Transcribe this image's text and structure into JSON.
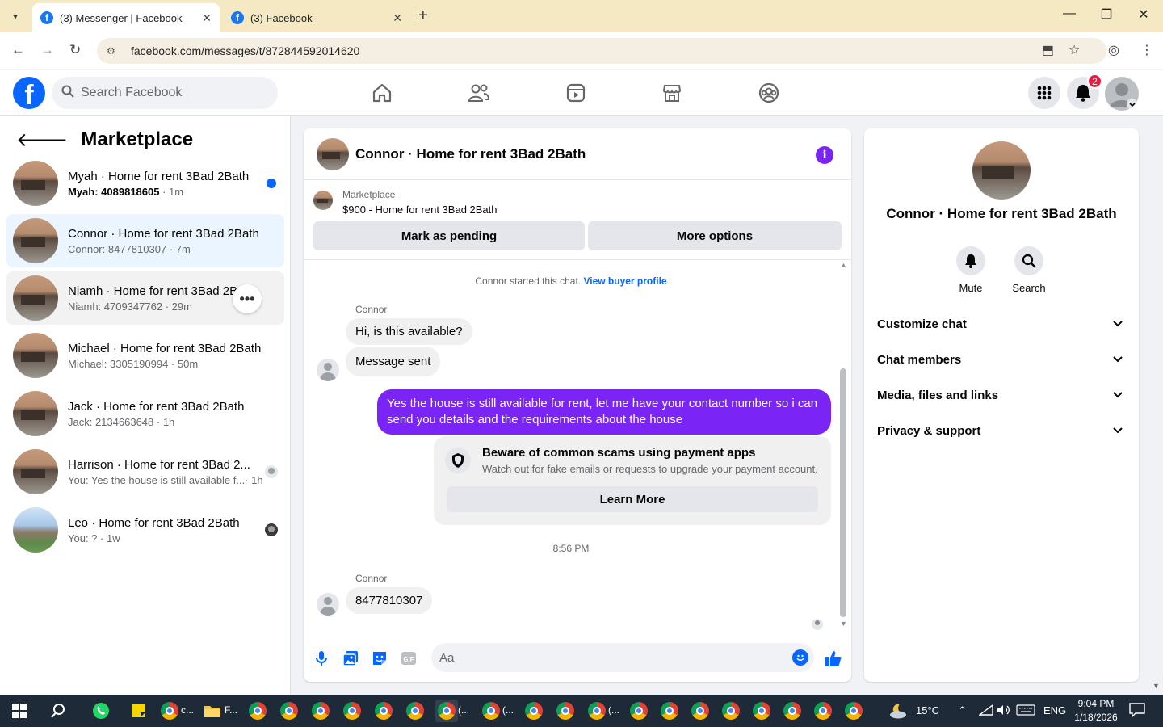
{
  "browser": {
    "tabs": [
      {
        "title": "(3) Messenger | Facebook",
        "active": true
      },
      {
        "title": "(3) Facebook",
        "active": false
      }
    ],
    "url": "facebook.com/messages/t/872844592014620"
  },
  "fb_header": {
    "search_placeholder": "Search Facebook",
    "notification_count": "2",
    "nav_icons": [
      "home-icon",
      "friends-icon",
      "video-icon",
      "marketplace-icon",
      "groups-icon"
    ]
  },
  "left_panel": {
    "title": "Marketplace",
    "conversations": [
      {
        "name": "Myah · Home for rent 3Bad 2Bath",
        "preview": "Myah: 4089818605",
        "time": " · 1m",
        "unread": true
      },
      {
        "name": "Connor · Home for rent 3Bad 2Bath",
        "preview": "Connor: 8477810307",
        "time": " · 7m",
        "selected": true
      },
      {
        "name": "Niamh · Home for rent 3Bad 2B",
        "preview": "Niamh: 4709347762",
        "time": " · 29m"
      },
      {
        "name": "Michael · Home for rent 3Bad 2Bath",
        "preview": "Michael: 3305190994",
        "time": " · 50m"
      },
      {
        "name": "Jack · Home for rent 3Bad 2Bath",
        "preview": "Jack: 2134663648",
        "time": " · 1h"
      },
      {
        "name": "Harrison · Home for rent 3Bad 2...",
        "preview": "You: Yes the house is still available f...",
        "time": " · 1h"
      },
      {
        "name": "Leo · Home for rent 3Bad 2Bath",
        "preview": "You: ?",
        "time": " · 1w"
      }
    ]
  },
  "chat": {
    "title": "Connor · Home for rent 3Bad 2Bath",
    "marketplace_label": "Marketplace",
    "listing": "$900 - Home for rent 3Bad 2Bath",
    "mark_pending": "Mark as pending",
    "more_options": "More options",
    "started_text": "Connor started this chat.",
    "view_profile": "View buyer profile",
    "sender1": "Connor",
    "msg1": "Hi, is this available?",
    "msg2": "Message sent",
    "msg_out": "Yes the house is still available for rent, let me have your contact number so i can send you details and the requirements about the house",
    "scam_title": "Beware of common scams using payment apps",
    "scam_desc": "Watch out for fake emails or requests to upgrade your payment account.",
    "learn_more": "Learn More",
    "timestamp": "8:56 PM",
    "sender2": "Connor",
    "msg3": "8477810307",
    "input_placeholder": "Aa"
  },
  "right_panel": {
    "name": "Connor · Home for rent 3Bad 2Bath",
    "mute_label": "Mute",
    "search_label": "Search",
    "sections": [
      "Customize chat",
      "Chat members",
      "Media, files and links",
      "Privacy & support"
    ]
  },
  "taskbar": {
    "weather": "15°C",
    "language": "ENG",
    "time": "9:04 PM",
    "date": "1/18/2026",
    "labels": {
      "c1": "c...",
      "files": "F...",
      "g1": "(...",
      "g2": "(...",
      "g3": "(..."
    }
  },
  "colors": {
    "accent": "#0866ff",
    "outgoing_bubble": "#7a24f5",
    "tabbar": "#f5e9c4",
    "taskbar": "#1f2a38"
  }
}
